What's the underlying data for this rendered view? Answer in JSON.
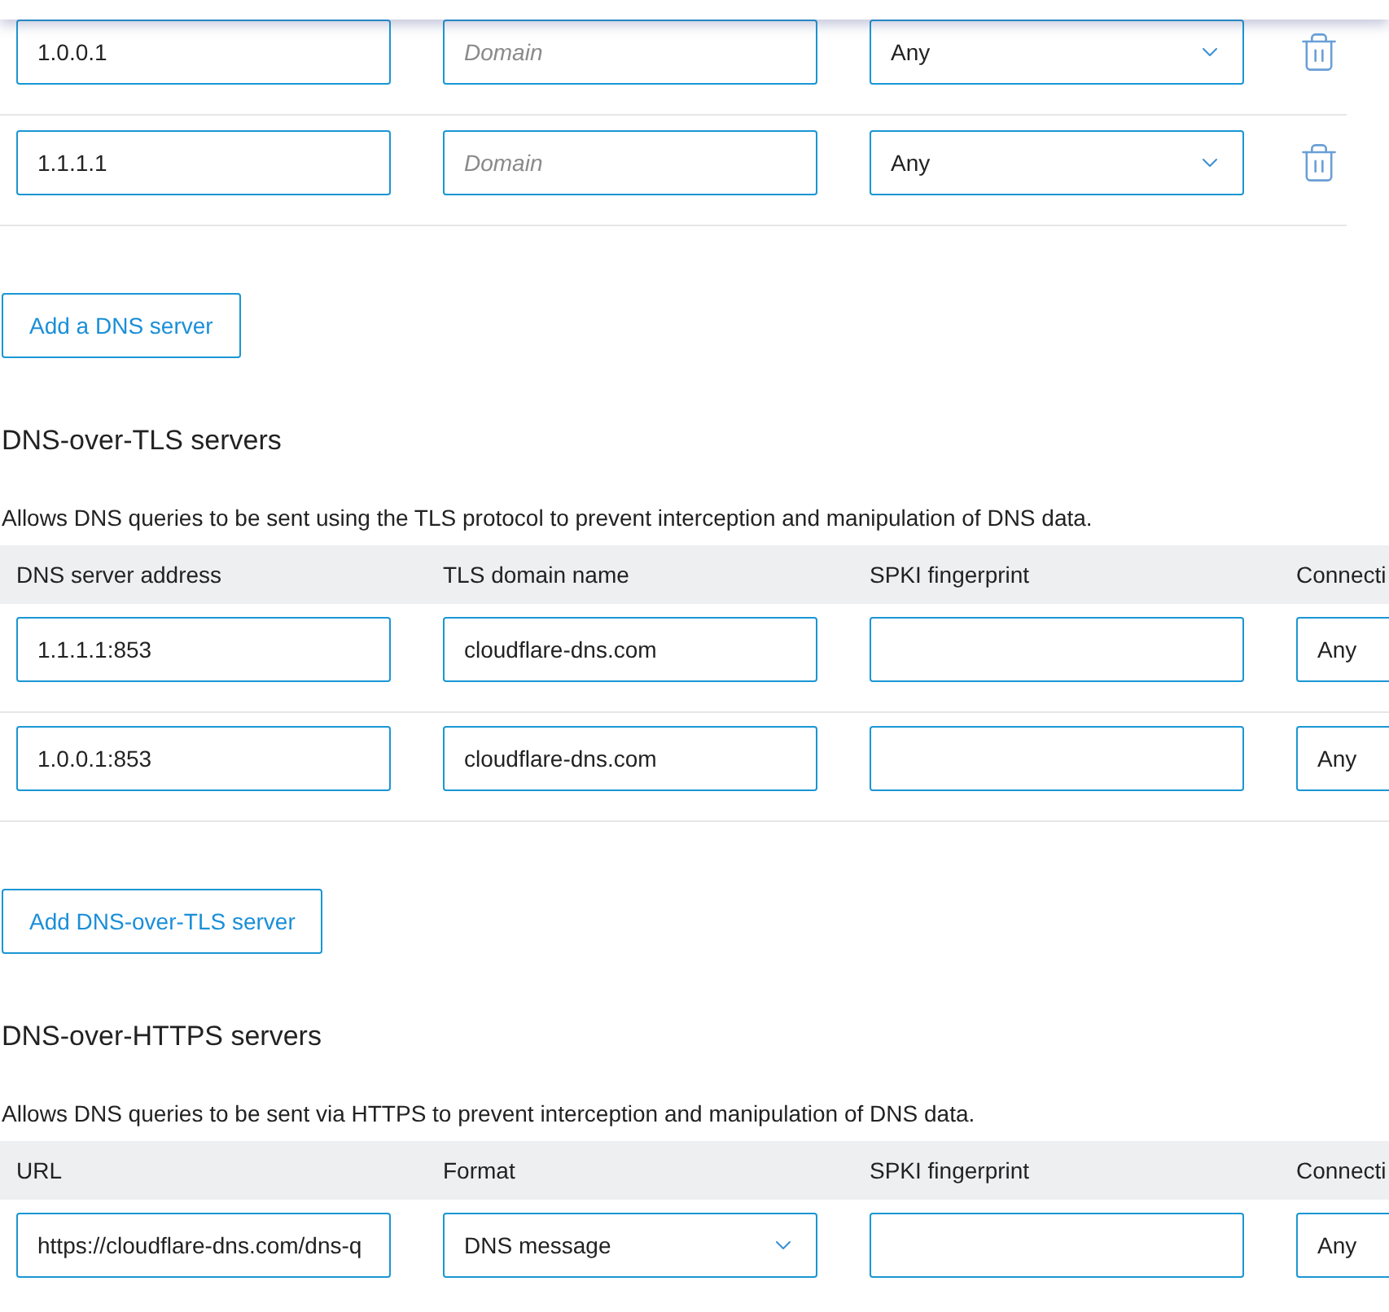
{
  "plain_servers": {
    "rows": [
      {
        "address": "1.0.0.1",
        "domain_placeholder": "Domain",
        "connection": "Any"
      },
      {
        "address": "1.1.1.1",
        "domain_placeholder": "Domain",
        "connection": "Any"
      }
    ],
    "add_button": "Add a DNS server"
  },
  "tls_servers": {
    "title": "DNS-over-TLS servers",
    "description": "Allows DNS queries to be sent using the TLS protocol to prevent interception and manipulation of DNS data.",
    "columns": [
      "DNS server address",
      "TLS domain name",
      "SPKI fingerprint",
      "Connecti"
    ],
    "rows": [
      {
        "address": "1.1.1.1:853",
        "tls_domain": "cloudflare-dns.com",
        "connection": "Any"
      },
      {
        "address": "1.0.0.1:853",
        "tls_domain": "cloudflare-dns.com",
        "connection": "Any"
      }
    ],
    "add_button": "Add DNS-over-TLS server"
  },
  "https_servers": {
    "title": "DNS-over-HTTPS servers",
    "description": "Allows DNS queries to be sent via HTTPS to prevent interception and manipulation of DNS data.",
    "columns": [
      "URL",
      "Format",
      "SPKI fingerprint",
      "Connecti"
    ],
    "rows": [
      {
        "url": "https://cloudflare-dns.com/dns-q",
        "format": "DNS message",
        "connection": "Any"
      }
    ]
  }
}
